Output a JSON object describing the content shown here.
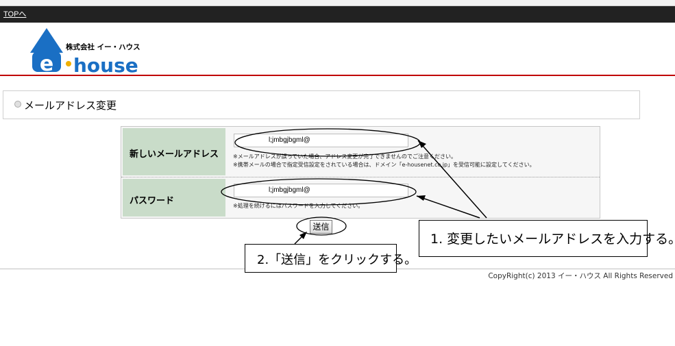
{
  "nav": {
    "top_link": "TOPへ"
  },
  "logo": {
    "company": "株式会社 イー・ハウス",
    "letter": "e",
    "word": "house"
  },
  "page": {
    "title": "メールアドレス変更"
  },
  "form": {
    "email": {
      "label": "新しいメールアドレス",
      "value": "l;jmbgjbgml@",
      "note1": "※メールアドレスが誤っていた場合、アドレス変更が完了できませんのでご注意ください。",
      "note2": "※携帯メールの場合で指定受信設定をされている場合は、ドメイン「e-housenet.co.jp」を受信可能に設定してください。"
    },
    "password": {
      "label": "パスワード",
      "value": "l;jmbgjbgml@",
      "note": "※処理を続けるにはパスワードを入力してください。"
    },
    "submit_label": "送信"
  },
  "annotations": {
    "step1": "1. 変更したいメールアドレスを入力する。",
    "step2": "2.「送信」をクリックする。"
  },
  "footer": {
    "copyright": "CopyRight(c) 2013 イー・ハウス All Rights Reserved"
  },
  "colors": {
    "topbar": "#222222",
    "accent_red": "#c00000",
    "label_bg": "#c9dcc9",
    "logo_blue": "#1a6fc4"
  }
}
